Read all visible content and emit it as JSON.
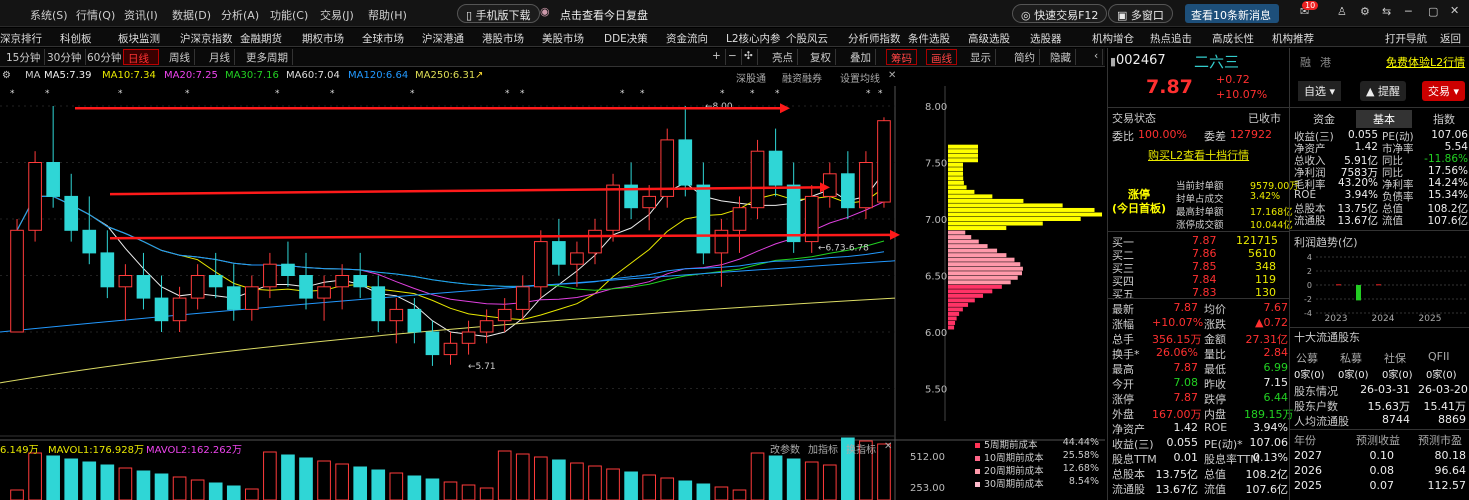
{
  "menu": {
    "items": [
      "系统(S)",
      "行情(Q)",
      "资讯(I)",
      "数据(D)",
      "分析(A)",
      "功能(C)",
      "交易(J)",
      "帮助(H)"
    ],
    "mobile": "手机版下载",
    "replay": "点击查看今日复盘",
    "quick_trade": "快速交易F12",
    "multi_window": "多窗口",
    "news": "查看10条新消息",
    "badge": "10"
  },
  "nav": [
    "深京排行",
    "科创板",
    "板块监测",
    "沪深京指数",
    "金融期货",
    "期权市场",
    "全球市场",
    "沪深港通",
    "港股市场",
    "美股市场",
    "DDE决策",
    "资金流向",
    "L2核心内参",
    "个股风云",
    "分析师指数",
    "条件选股",
    "高级选股",
    "选股器",
    "机构增仓",
    "热点追击",
    "高成长性",
    "机构推荐",
    "打开导航",
    "返回"
  ],
  "toolbar": {
    "periods": [
      "15分钟",
      "30分钟",
      "60分钟",
      "日线",
      "周线",
      "月线",
      "更多周期"
    ],
    "tools": [
      "亮点",
      "复权",
      "叠加",
      "筹码",
      "画线",
      "显示",
      "简约",
      "隐藏"
    ],
    "sub": [
      "深股通",
      "融资融券",
      "设置均线"
    ]
  },
  "ma": {
    "label": "MA",
    "ma5": "MA5:7.39",
    "ma10": "MA10:7.34",
    "ma20": "MA20:7.25",
    "ma30": "MA30:7.16",
    "ma60": "MA60:7.04",
    "ma120": "MA120:6.64",
    "ma250": "MA250:6.31"
  },
  "vol": {
    "v": "6.149万",
    "mavol1": "MAVOL1:176.928万",
    "mavol2": "MAVOL2:162.262万",
    "tools": [
      "改参数",
      "加指标",
      "换指标"
    ]
  },
  "chart_data": {
    "type": "candlestick",
    "yticks": [
      "8.00",
      "7.50",
      "7.00",
      "6.50",
      "6.00",
      "5.50"
    ],
    "vticks": [
      "512.00",
      "253.00"
    ],
    "annotations": [
      "8.00",
      "5.71",
      "6.73-6.78"
    ],
    "candles": [
      [
        6.0,
        7.0,
        6.2,
        6.9
      ],
      [
        6.9,
        7.6,
        6.8,
        7.5
      ],
      [
        7.5,
        8.0,
        7.1,
        7.2
      ],
      [
        7.2,
        7.4,
        6.8,
        6.9
      ],
      [
        6.9,
        7.2,
        6.6,
        6.7
      ],
      [
        6.7,
        6.9,
        6.3,
        6.4
      ],
      [
        6.4,
        6.6,
        6.1,
        6.5
      ],
      [
        6.5,
        6.7,
        6.2,
        6.3
      ],
      [
        6.3,
        6.5,
        6.0,
        6.1
      ],
      [
        6.1,
        6.4,
        6.0,
        6.3
      ],
      [
        6.3,
        6.6,
        6.2,
        6.5
      ],
      [
        6.5,
        6.7,
        6.3,
        6.4
      ],
      [
        6.4,
        6.6,
        6.1,
        6.2
      ],
      [
        6.2,
        6.5,
        6.1,
        6.4
      ],
      [
        6.4,
        6.7,
        6.3,
        6.6
      ],
      [
        6.6,
        6.8,
        6.4,
        6.5
      ],
      [
        6.5,
        6.7,
        6.2,
        6.3
      ],
      [
        6.3,
        6.5,
        6.1,
        6.4
      ],
      [
        6.4,
        6.6,
        6.2,
        6.5
      ],
      [
        6.5,
        6.7,
        6.3,
        6.4
      ],
      [
        6.4,
        6.5,
        6.0,
        6.1
      ],
      [
        6.1,
        6.3,
        5.9,
        6.2
      ],
      [
        6.2,
        6.3,
        5.9,
        6.0
      ],
      [
        6.0,
        6.1,
        5.7,
        5.8
      ],
      [
        5.8,
        6.0,
        5.71,
        5.9
      ],
      [
        5.9,
        6.1,
        5.8,
        6.0
      ],
      [
        6.0,
        6.2,
        5.9,
        6.1
      ],
      [
        6.1,
        6.3,
        6.0,
        6.2
      ],
      [
        6.2,
        6.5,
        6.1,
        6.4
      ],
      [
        6.4,
        6.9,
        6.3,
        6.8
      ],
      [
        6.8,
        7.0,
        6.5,
        6.6
      ],
      [
        6.6,
        6.8,
        6.4,
        6.7
      ],
      [
        6.7,
        7.0,
        6.6,
        6.9
      ],
      [
        6.9,
        7.4,
        6.8,
        7.3
      ],
      [
        7.3,
        7.5,
        7.0,
        7.1
      ],
      [
        7.1,
        7.3,
        6.9,
        7.2
      ],
      [
        7.2,
        7.8,
        7.1,
        7.7
      ],
      [
        7.7,
        8.0,
        7.2,
        7.3
      ],
      [
        7.3,
        7.5,
        6.6,
        6.7
      ],
      [
        6.7,
        7.0,
        6.4,
        6.9
      ],
      [
        6.9,
        7.2,
        6.7,
        7.1
      ],
      [
        7.1,
        7.7,
        7.0,
        7.6
      ],
      [
        7.6,
        7.8,
        7.2,
        7.3
      ],
      [
        7.3,
        7.5,
        6.7,
        6.8
      ],
      [
        6.8,
        7.3,
        6.7,
        7.2
      ],
      [
        7.2,
        7.5,
        7.1,
        7.4
      ],
      [
        7.4,
        7.6,
        7.0,
        7.1
      ],
      [
        7.1,
        7.6,
        7.0,
        7.5
      ],
      [
        7.15,
        7.9,
        7.1,
        7.87
      ]
    ]
  },
  "quote": {
    "code": "002467",
    "name": "二六三",
    "price": "7.87",
    "change": "+0.72",
    "pct": "+10.07%",
    "tags": [
      "融",
      "港"
    ],
    "self_select": "自选",
    "hint": "提醒",
    "trade": "交易",
    "l2": "免费体验L2行情",
    "status_l": "交易状态",
    "status_r": "已收市",
    "weibi_l": "委比",
    "weibi": "100.00%",
    "weicha_l": "委差",
    "weicha": "127922",
    "l2_link": "购买L2查看十档行情",
    "limit_title": "涨停\n(今日首板)",
    "limit_rows": [
      [
        "当前封单额",
        "9579.00万"
      ],
      [
        "封单占成交",
        "3.42%"
      ],
      [
        "最高封单额",
        "17.168亿"
      ],
      [
        "涨停成交额",
        "10.044亿"
      ]
    ],
    "buys": [
      [
        "买一",
        "7.87",
        "121715"
      ],
      [
        "买二",
        "7.86",
        "5610"
      ],
      [
        "买三",
        "7.85",
        "348"
      ],
      [
        "买四",
        "7.84",
        "119"
      ],
      [
        "买五",
        "7.83",
        "130"
      ]
    ],
    "stats": [
      [
        "最新",
        "7.87",
        "均价",
        "7.67"
      ],
      [
        "涨幅",
        "+10.07%",
        "涨跌",
        "▲0.72"
      ],
      [
        "总手",
        "356.15万",
        "金额",
        "27.31亿"
      ],
      [
        "换手*",
        "26.06%",
        "量比",
        "2.84"
      ],
      [
        "最高",
        "7.87",
        "最低",
        "6.99"
      ],
      [
        "今开",
        "7.08",
        "昨收",
        "7.15"
      ],
      [
        "涨停",
        "7.87",
        "跌停",
        "6.44"
      ],
      [
        "外盘",
        "167.00万",
        "内盘",
        "189.15万"
      ],
      [
        "净资产",
        "1.42",
        "ROE",
        "3.94%"
      ],
      [
        "收益(三)",
        "0.055",
        "PE(动)*",
        "107.06"
      ],
      [
        "股息TTM",
        "0.01",
        "股息率TTM",
        "0.13%"
      ],
      [
        "总股本",
        "13.75亿",
        "总值",
        "108.2亿"
      ],
      [
        "流通股",
        "13.67亿",
        "流值",
        "107.6亿"
      ]
    ]
  },
  "fund": {
    "tabs": [
      "资金",
      "基本",
      "指数"
    ],
    "rows": [
      [
        "收益(三)",
        "0.055",
        "PE(动)",
        "107.06"
      ],
      [
        "净资产",
        "1.42",
        "市净率",
        "5.54"
      ],
      [
        "总收入",
        "5.91亿",
        "同比",
        "-11.86%"
      ],
      [
        "净利润",
        "7583万",
        "同比",
        "17.56%"
      ],
      [
        "毛利率",
        "43.20%",
        "净利率",
        "14.24%"
      ],
      [
        "ROE",
        "3.94%",
        "负债率",
        "15.34%"
      ],
      [
        "总股本",
        "13.75亿",
        "总值",
        "108.2亿"
      ],
      [
        "流通股",
        "13.67亿",
        "流值",
        "107.6亿"
      ]
    ],
    "trend_title": "利润趋势(亿)",
    "trend_ylabels": [
      "4",
      "2",
      "0",
      "-2",
      "-4"
    ],
    "trend_years": [
      "2023",
      "2024",
      "2025"
    ],
    "trend_values": [
      0.1,
      -2.2,
      0.1
    ],
    "holders_title": "十大流通股东",
    "holders_head": [
      "公募",
      "私募",
      "社保",
      "QFII"
    ],
    "holders_vals": [
      "0家(0)",
      "0家(0)",
      "0家(0)",
      "0家(0)"
    ],
    "hrows": [
      [
        "股东情况",
        "26-03-31",
        "26-03-20"
      ],
      [
        "股东户数",
        "15.63万",
        "15.41万"
      ],
      [
        "人均流通股",
        "8744",
        "8869"
      ]
    ],
    "fc_head": [
      "年份",
      "预测收益",
      "预测市盈"
    ],
    "fc_rows": [
      [
        "2027",
        "0.10",
        "80.18"
      ],
      [
        "2026",
        "0.08",
        "96.64"
      ],
      [
        "2025",
        "0.07",
        "112.57"
      ]
    ]
  },
  "costs": [
    [
      "5周期前成本",
      "44.44%"
    ],
    [
      "10周期前成本",
      "25.58%"
    ],
    [
      "20周期前成本",
      "12.68%"
    ],
    [
      "30周期前成本",
      "8.54%"
    ]
  ]
}
